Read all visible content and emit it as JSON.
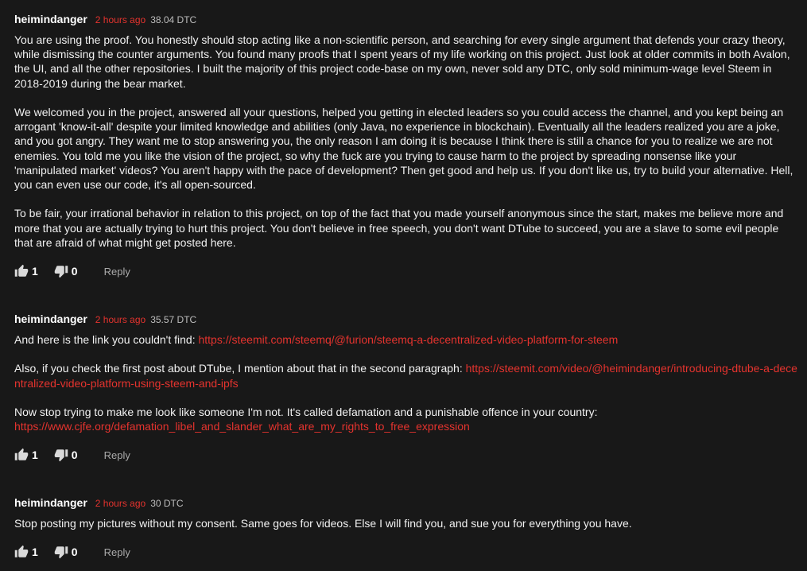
{
  "comments": [
    {
      "author": "heimindanger",
      "time": "2 hours ago",
      "dtc": "38.04 DTC",
      "paragraphs": [
        "You are using the proof. You honestly should stop acting like a non-scientific person, and searching for every single argument that defends your crazy theory, while dismissing the counter arguments. You found many proofs that I spent years of my life working on this project. Just look at older commits in both Avalon, the UI, and all the other repositories. I built the majority of this project code-base on my own, never sold any DTC, only sold minimum-wage level Steem in 2018-2019 during the bear market.",
        "We welcomed you in the project, answered all your questions, helped you getting in elected leaders so you could access the channel, and you kept being an arrogant 'know-it-all' despite your limited knowledge and abilities (only Java, no experience in blockchain). Eventually all the leaders realized you are a joke, and you got angry. They want me to stop answering you, the only reason I am doing it is because I think there is still a chance for you to realize we are not enemies. You told me you like the vision of the project, so why the fuck are you trying to cause harm to the project by spreading nonsense like your 'manipulated market' videos? You aren't happy with the pace of development? Then get good and help us. If you don't like us, try to build your alternative. Hell, you can even use our code, it's all open-sourced.",
        "To be fair, your irrational behavior in relation to this project, on top of the fact that you made yourself anonymous since the start, makes me believe more and more that you are actually trying to hurt this project. You don't believe in free speech, you don't want DTube to succeed, you are a slave to some evil people that are afraid of what might get posted here."
      ],
      "likes": "1",
      "dislikes": "0",
      "reply_label": "Reply"
    },
    {
      "author": "heimindanger",
      "time": "2 hours ago",
      "dtc": "35.57 DTC",
      "p1_text": "And here is the link you couldn't find: ",
      "p1_link": "https://steemit.com/steemq/@furion/steemq-a-decentralized-video-platform-for-steem",
      "p2_text": "Also, if you check the first post about DTube, I mention about that in the second paragraph: ",
      "p2_link": "https://steemit.com/video/@heimindanger/introducing-dtube-a-decentralized-video-platform-using-steem-and-ipfs",
      "p3_text": "Now stop trying to make me look like someone I'm not. It's called defamation and a punishable offence in your country: ",
      "p3_link": "https://www.cjfe.org/defamation_libel_and_slander_what_are_my_rights_to_free_expression",
      "likes": "1",
      "dislikes": "0",
      "reply_label": "Reply"
    },
    {
      "author": "heimindanger",
      "time": "2 hours ago",
      "dtc": "30 DTC",
      "paragraphs": [
        "Stop posting my pictures without my consent. Same goes for videos. Else I will find you, and sue you for everything you have."
      ],
      "likes": "1",
      "dislikes": "0",
      "reply_label": "Reply"
    }
  ],
  "icons": {
    "like": "thumbs-up-icon",
    "dislike": "thumbs-down-icon"
  },
  "colors": {
    "background": "#181818",
    "accent": "#e4332e",
    "text": "#f1f1f1",
    "muted": "#aaaaaa"
  }
}
